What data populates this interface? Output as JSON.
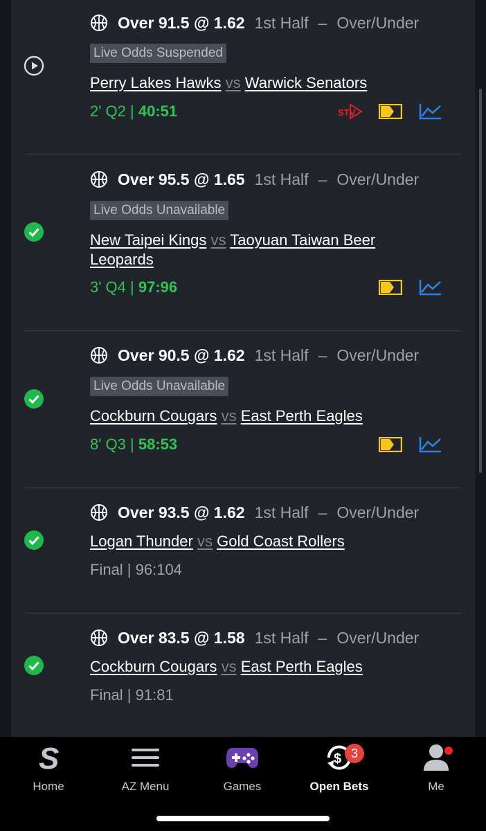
{
  "bets": [
    {
      "status": "live",
      "selection": "Over 91.5 @ 1.62",
      "period": "1st Half",
      "dash": "–",
      "market": "Over/Under",
      "odds_notice": "Live Odds Suspended",
      "home_team": "Perry Lakes Hawks",
      "vs": "vs",
      "away_team": "Warwick Senators",
      "clock": "2' Q2 | ",
      "score": "40:51",
      "actions": [
        "stv-icon",
        "live-stream-icon",
        "stats-chart-icon"
      ]
    },
    {
      "status": "won",
      "selection": "Over 95.5 @ 1.65",
      "period": "1st Half",
      "dash": "–",
      "market": "Over/Under",
      "odds_notice": "Live Odds Unavailable",
      "home_team": "New Taipei Kings",
      "vs": "vs",
      "away_team": "Taoyuan Taiwan Beer Leopards",
      "clock": "3' Q4 | ",
      "score": "97:96",
      "actions": [
        "live-stream-icon",
        "stats-chart-icon"
      ]
    },
    {
      "status": "won",
      "selection": "Over 90.5 @ 1.62",
      "period": "1st Half",
      "dash": "–",
      "market": "Over/Under",
      "odds_notice": "Live Odds Unavailable",
      "home_team": "Cockburn Cougars",
      "vs": "vs",
      "away_team": "East Perth Eagles",
      "clock": "8' Q3 | ",
      "score": "58:53",
      "actions": [
        "live-stream-icon",
        "stats-chart-icon"
      ]
    },
    {
      "status": "won",
      "selection": "Over 93.5 @ 1.62",
      "period": "1st Half",
      "dash": "–",
      "market": "Over/Under",
      "home_team": "Logan Thunder",
      "vs": "vs",
      "away_team": "Gold Coast Rollers",
      "final": "Final | 96:104"
    },
    {
      "status": "won",
      "selection": "Over 83.5 @ 1.58",
      "period": "1st Half",
      "dash": "–",
      "market": "Over/Under",
      "home_team": "Cockburn Cougars",
      "vs": "vs",
      "away_team": "East Perth Eagles",
      "final": "Final | 91:81"
    }
  ],
  "stv_label": "STV",
  "tabbar": {
    "home": "Home",
    "az_menu": "AZ Menu",
    "games": "Games",
    "open_bets": "Open Bets",
    "open_bets_count": "3",
    "me": "Me"
  },
  "colors": {
    "live_green": "#2ec553",
    "check_green": "#1fb84a",
    "stream_yellow": "#f5c518",
    "chart_blue": "#2f7fe0",
    "stv_red": "#e0202a"
  }
}
